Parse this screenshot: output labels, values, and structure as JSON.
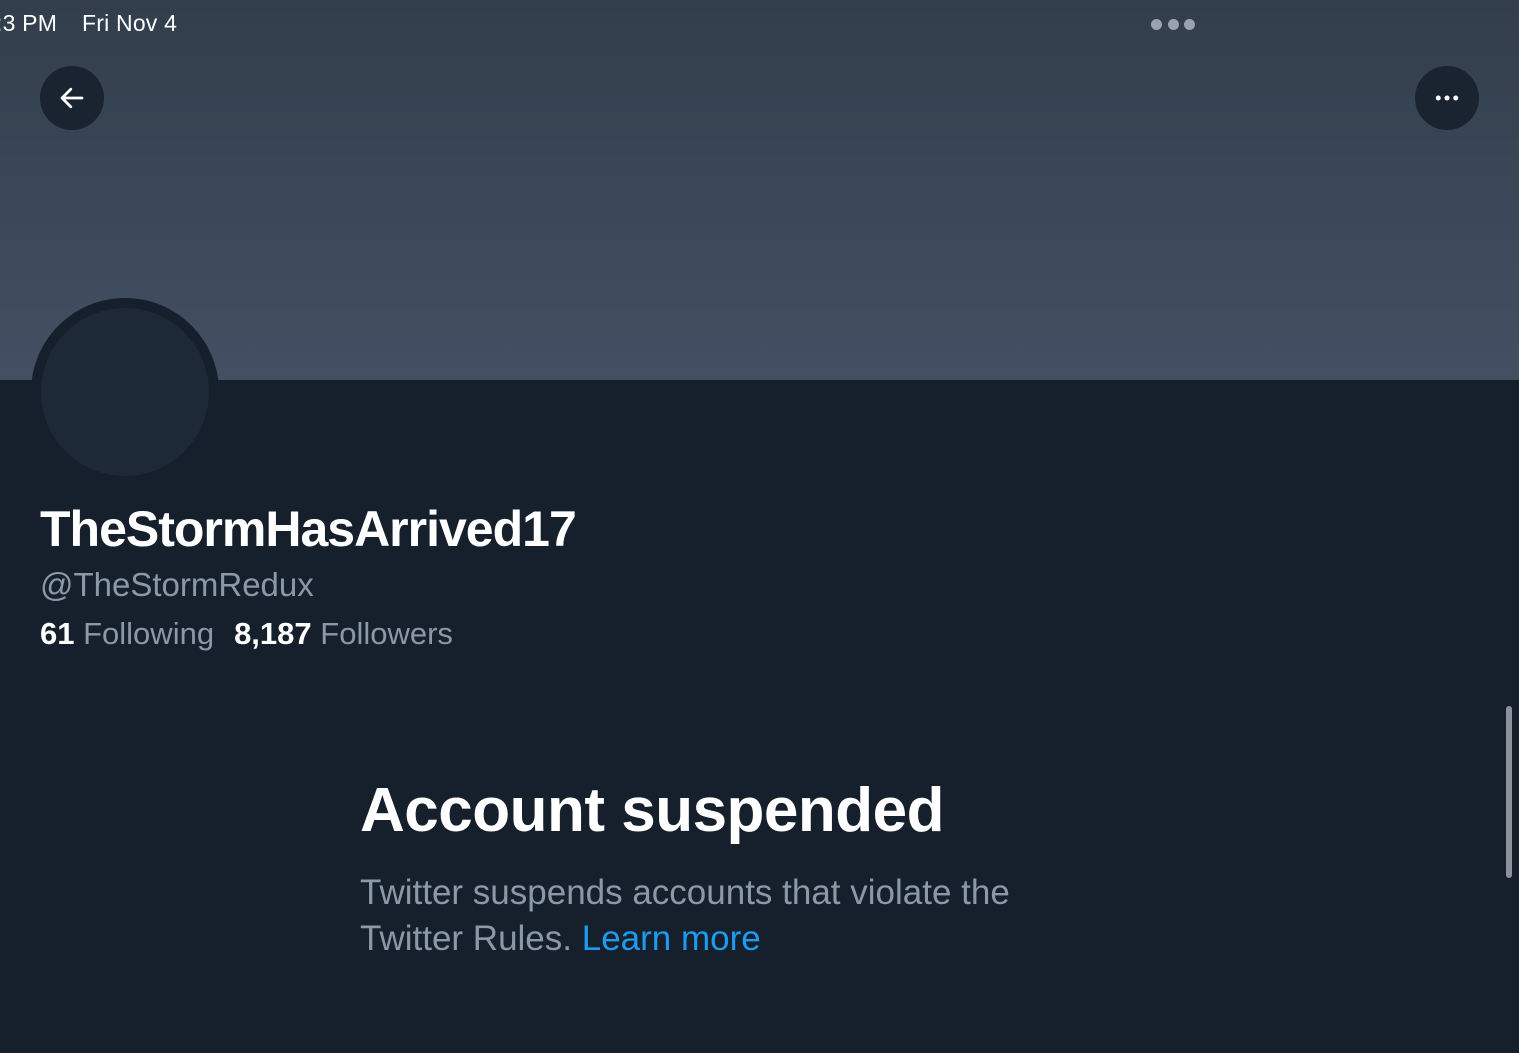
{
  "status_bar": {
    "time": ":3 PM",
    "date": "Fri Nov 4"
  },
  "header": {
    "back_icon": "arrow-left-icon",
    "more_icon": "ellipsis-icon"
  },
  "profile": {
    "display_name": "TheStormHasArrived17",
    "handle": "@TheStormRedux",
    "following_count": "61",
    "following_label": "Following",
    "followers_count": "8,187",
    "followers_label": "Followers"
  },
  "notice": {
    "title": "Account suspended",
    "body": "Twitter suspends accounts that violate the Twitter Rules.",
    "link_label": "Learn more"
  },
  "colors": {
    "background": "#16202c",
    "link": "#1d9bf0",
    "secondary_text": "#8b98a5"
  }
}
